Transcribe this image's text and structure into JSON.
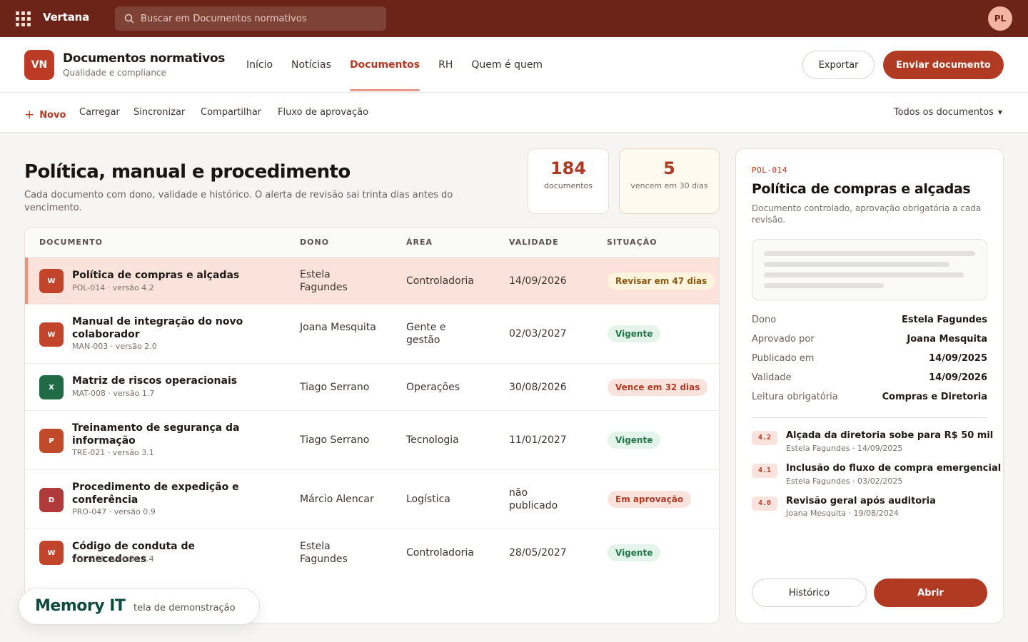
{
  "topbar": {
    "brand": "Vertana",
    "search_placeholder": "Buscar em Documentos normativos",
    "avatar": "PL"
  },
  "app": {
    "logo": "VN",
    "title": "Documentos normativos",
    "subtitle": "Qualidade e compliance",
    "nav": [
      "Início",
      "Notícias",
      "Documentos",
      "RH",
      "Quem é quem"
    ],
    "nav_active": "Documentos",
    "export_label": "Exportar",
    "send_label": "Enviar documento"
  },
  "commands": {
    "new": "Novo",
    "upload": "Carregar",
    "sync": "Sincronizar",
    "share": "Compartilhar",
    "flow": "Fluxo de aprovação",
    "filter": "Todos os documentos"
  },
  "main": {
    "title": "Política, manual e procedimento",
    "description": "Cada documento com dono, validade e histórico. O alerta de revisão sai trinta dias antes do vencimento.",
    "stats": [
      {
        "value": "184",
        "label": "documentos"
      },
      {
        "value": "5",
        "label": "vencem em 30 dias"
      }
    ]
  },
  "table": {
    "headers": [
      "DOCUMENTO",
      "DONO",
      "ÁREA",
      "VALIDADE",
      "SITUAÇÃO"
    ],
    "rows": [
      {
        "icon": "W",
        "name": "Política de compras e alçadas",
        "code": "POL-014 · versão 4.2",
        "owner": "Estela Fagundes",
        "area": "Controladoria",
        "validity": "14/09/2026",
        "status": "Revisar em 47 dias",
        "status_type": "warn",
        "selected": true
      },
      {
        "icon": "W",
        "name": "Manual de integração do novo colaborador",
        "code": "MAN-003 · versão 2.0",
        "owner": "Joana Mesquita",
        "area": "Gente e gestão",
        "validity": "02/03/2027",
        "status": "Vigente",
        "status_type": "ok",
        "selected": false
      },
      {
        "icon": "X",
        "name": "Matriz de riscos operacionais",
        "code": "MAT-008 · versão 1.7",
        "owner": "Tiago Serrano",
        "area": "Operações",
        "validity": "30/08/2026",
        "status": "Vence em 32 dias",
        "status_type": "danger",
        "selected": false
      },
      {
        "icon": "P",
        "name": "Treinamento de segurança da informação",
        "code": "TRE-021 · versão 3.1",
        "owner": "Tiago Serrano",
        "area": "Tecnologia",
        "validity": "11/01/2027",
        "status": "Vigente",
        "status_type": "ok",
        "selected": false
      },
      {
        "icon": "D",
        "name": "Procedimento de expedição e conferência",
        "code": "PRO-047 · versão 0.9",
        "owner": "Márcio Alencar",
        "area": "Logística",
        "validity": "não publicado",
        "status": "Em aprovação",
        "status_type": "pend",
        "selected": false
      },
      {
        "icon": "W",
        "name": "Código de conduta de fornecedores",
        "code": "POL-021 · versão 1.4",
        "owner": "Estela Fagundes",
        "area": "Controladoria",
        "validity": "28/05/2027",
        "status": "Vigente",
        "status_type": "ok",
        "selected": false
      }
    ]
  },
  "panel": {
    "code": "POL-014",
    "title": "Política de compras e alçadas",
    "description": "Documento controlado, aprovação obrigatória a cada revisão.",
    "meta": [
      {
        "key": "Dono",
        "value": "Estela Fagundes"
      },
      {
        "key": "Aprovado por",
        "value": "Joana Mesquita"
      },
      {
        "key": "Publicado em",
        "value": "14/09/2025"
      },
      {
        "key": "Validade",
        "value": "14/09/2026"
      },
      {
        "key": "Leitura obrigatória",
        "value": "Compras e Diretoria"
      }
    ],
    "versions": [
      {
        "version": "4.2",
        "title": "Alçada da diretoria sobe para R$ 50 mil",
        "meta": "Estela Fagundes · 14/09/2025"
      },
      {
        "version": "4.1",
        "title": "Inclusão do fluxo de compra emergencial",
        "meta": "Estela Fagundes · 03/02/2025"
      },
      {
        "version": "4.0",
        "title": "Revisão geral após auditoria",
        "meta": "Joana Mesquita · 19/08/2024"
      }
    ],
    "history_label": "Histórico",
    "open_label": "Abrir"
  },
  "badge": {
    "brand": "Memory IT",
    "subtitle": "tela de demonstração"
  },
  "colors": {
    "topbar": "#6b2417",
    "accent": "#b13a22",
    "icon_word": "#c2452b",
    "icon_excel": "#1e6b45",
    "icon_ppt": "#c04a2a",
    "icon_pdf": "#b03a3a"
  }
}
